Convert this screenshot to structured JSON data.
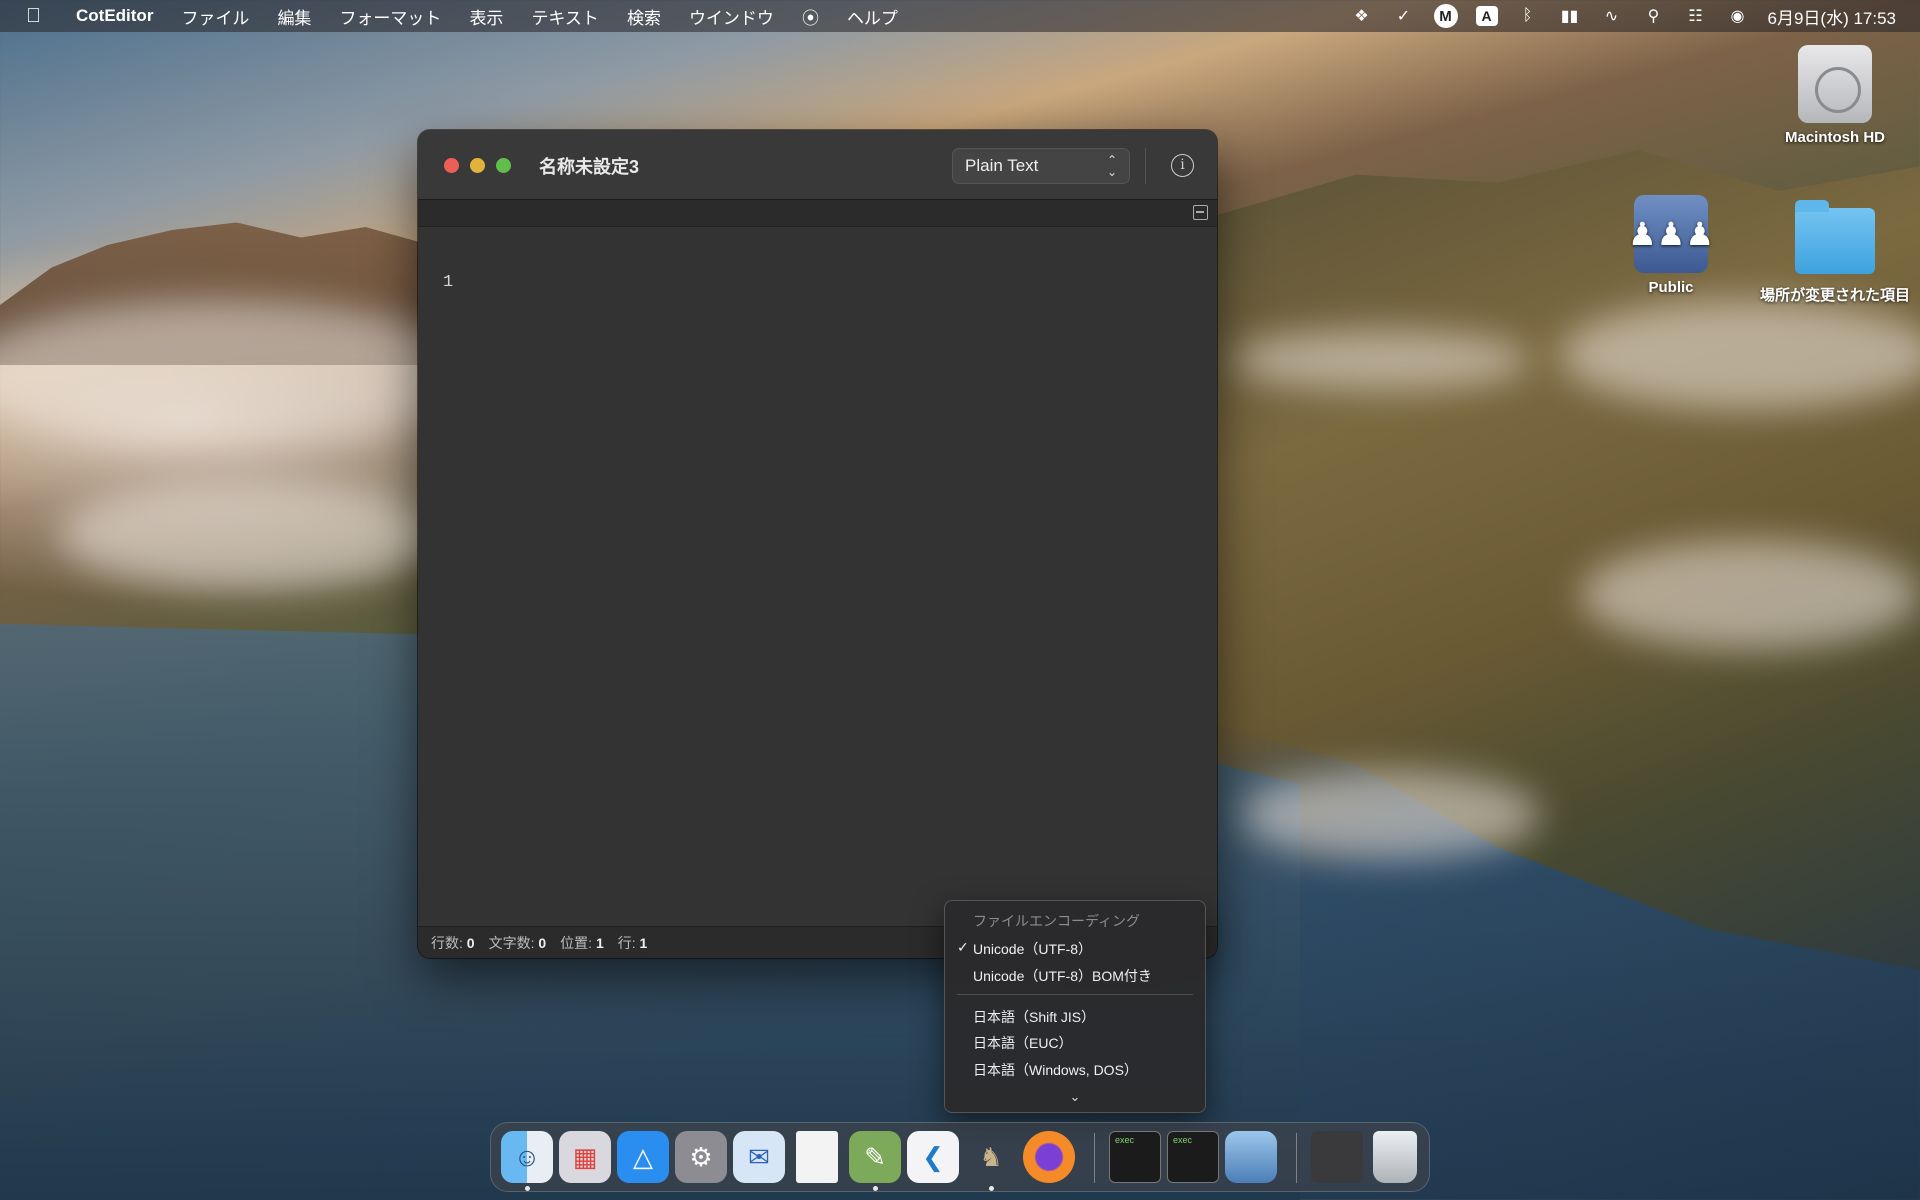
{
  "menubar": {
    "apple_icon": "apple-logo",
    "app_name": "CotEditor",
    "items": [
      "ファイル",
      "編集",
      "フォーマット",
      "表示",
      "テキスト",
      "検索",
      "ウインドウ",
      "ヘルプ"
    ],
    "script_icon": "script-menu-icon",
    "status_icons": [
      "dropbox-icon",
      "task-check-icon",
      "m-app-icon",
      "input-source-icon",
      "bluetooth-icon",
      "battery-icon",
      "wifi-icon",
      "spotlight-icon",
      "control-center-icon",
      "siri-icon"
    ],
    "input_source_label": "A",
    "m_app_label": "M",
    "clock": "6月9日(水) 17:53"
  },
  "desktop": {
    "icons": [
      {
        "label": "Macintosh HD",
        "icon": "hard-drive-icon"
      },
      {
        "label": "Public",
        "icon": "shared-folder-icon"
      },
      {
        "label": "場所が変更された項目",
        "icon": "folder-icon"
      }
    ]
  },
  "window": {
    "title": "名称未設定3",
    "syntax_style": "Plain Text",
    "line_number": "1",
    "status": {
      "lines_label": "行数:",
      "lines_value": "0",
      "chars_label": "文字数:",
      "chars_value": "0",
      "location_label": "位置:",
      "location_value": "1",
      "line_label": "行:",
      "line_value": "1"
    }
  },
  "encoding_menu": {
    "header": "ファイルエンコーディング",
    "items": [
      {
        "label": "Unicode（UTF-8）",
        "checked": true
      },
      {
        "label": "Unicode（UTF-8）BOM付き",
        "checked": false
      },
      {
        "label": "日本語（Shift JIS）",
        "checked": false
      },
      {
        "label": "日本語（EUC）",
        "checked": false
      },
      {
        "label": "日本語（Windows, DOS）",
        "checked": false
      }
    ],
    "checkmark": "✓",
    "more_indicator": "⌄"
  },
  "dock": {
    "apps": [
      "finder",
      "launchpad",
      "app-store",
      "system-preferences",
      "thunderbird",
      "textedit-document",
      "coteditor",
      "vscode",
      "gimp",
      "firefox",
      "exec-terminal-1",
      "exec-terminal-2",
      "preview",
      "screenshot",
      "trash"
    ],
    "exec_label": "exec"
  }
}
